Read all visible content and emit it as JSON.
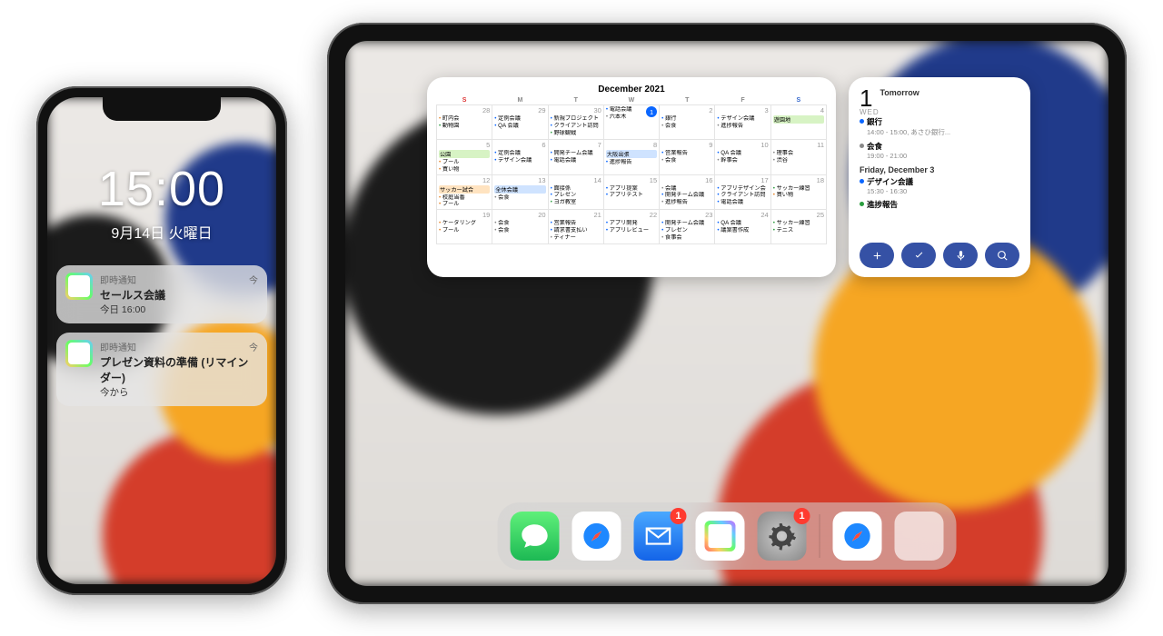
{
  "iphone": {
    "time": "15:00",
    "date": "9月14日 火曜日",
    "notifications": [
      {
        "app_label": "即時通知",
        "time_label": "今",
        "title": "セールス会議",
        "subtitle": "今日 16:00"
      },
      {
        "app_label": "即時通知",
        "time_label": "今",
        "title": "プレゼン資料の準備 (リマインダー)",
        "subtitle": "今から"
      }
    ]
  },
  "ipad": {
    "calendar_widget": {
      "title": "December 2021",
      "day_headers": [
        "S",
        "M",
        "T",
        "W",
        "T",
        "F",
        "S"
      ],
      "today_date": 1,
      "weeks": [
        [
          {
            "num": 28,
            "events": [
              {
                "c": "orange",
                "t": "町内会"
              },
              {
                "c": "green",
                "t": "動物園"
              }
            ]
          },
          {
            "num": 29,
            "events": [
              {
                "c": "blue",
                "t": "定例会議"
              },
              {
                "c": "blue",
                "t": "QA 会議"
              }
            ]
          },
          {
            "num": 30,
            "events": [
              {
                "c": "blue",
                "t": "新規プロジェクト"
              },
              {
                "c": "blue",
                "t": "クライアント訪問"
              },
              {
                "c": "green",
                "t": "野球観戦"
              }
            ]
          },
          {
            "num": 1,
            "today": true,
            "events": [
              {
                "c": "blue",
                "t": "電話会議"
              },
              {
                "c": "gray",
                "t": "六本木"
              }
            ]
          },
          {
            "num": 2,
            "events": [
              {
                "c": "blue",
                "t": "銀行"
              },
              {
                "c": "gray",
                "t": "会食"
              }
            ]
          },
          {
            "num": 3,
            "events": [
              {
                "c": "blue",
                "t": "デザイン会議"
              },
              {
                "c": "gray",
                "t": "進捗報告"
              }
            ]
          },
          {
            "num": 4,
            "allday": {
              "c": "green",
              "t": "遊園地"
            }
          }
        ],
        [
          {
            "num": 5,
            "allday": {
              "c": "green",
              "t": "公園"
            },
            "events": [
              {
                "c": "orange",
                "t": "プール"
              },
              {
                "c": "orange",
                "t": "買い物"
              }
            ]
          },
          {
            "num": 6,
            "events": [
              {
                "c": "blue",
                "t": "定例会議"
              },
              {
                "c": "blue",
                "t": "デザイン会議"
              }
            ]
          },
          {
            "num": 7,
            "events": [
              {
                "c": "blue",
                "t": "開発チーム会議"
              },
              {
                "c": "blue",
                "t": "電話会議"
              }
            ]
          },
          {
            "num": 8,
            "allday": {
              "c": "blue",
              "t": "大阪出張"
            },
            "events": [
              {
                "c": "blue",
                "t": "進捗報告"
              }
            ]
          },
          {
            "num": 9,
            "events": [
              {
                "c": "blue",
                "t": "営業報告"
              },
              {
                "c": "gray",
                "t": "会食"
              }
            ]
          },
          {
            "num": 10,
            "events": [
              {
                "c": "blue",
                "t": "QA 会議"
              },
              {
                "c": "gray",
                "t": "幹事会"
              }
            ]
          },
          {
            "num": 11,
            "events": [
              {
                "c": "gray",
                "t": "理事会"
              },
              {
                "c": "gray",
                "t": "渋谷"
              }
            ]
          }
        ],
        [
          {
            "num": 12,
            "allday": {
              "c": "orange",
              "t": "サッカー試合"
            },
            "events": [
              {
                "c": "orange",
                "t": "校庭当番"
              },
              {
                "c": "orange",
                "t": "プール"
              }
            ]
          },
          {
            "num": 13,
            "allday": {
              "c": "blue",
              "t": "全休会議"
            },
            "events": [
              {
                "c": "gray",
                "t": "会食"
              }
            ]
          },
          {
            "num": 14,
            "events": [
              {
                "c": "blue",
                "t": "面接係"
              },
              {
                "c": "blue",
                "t": "プレゼン"
              },
              {
                "c": "green",
                "t": "ヨガ教室"
              }
            ]
          },
          {
            "num": 15,
            "events": [
              {
                "c": "blue",
                "t": "アプリ提案"
              },
              {
                "c": "blue",
                "t": "アプリテスト"
              }
            ]
          },
          {
            "num": 16,
            "events": [
              {
                "c": "gray",
                "t": "会議"
              },
              {
                "c": "blue",
                "t": "開発チーム会議"
              },
              {
                "c": "gray",
                "t": "進捗報告"
              }
            ]
          },
          {
            "num": 17,
            "events": [
              {
                "c": "blue",
                "t": "アプリデザイン会"
              },
              {
                "c": "blue",
                "t": "クライアント訪問"
              },
              {
                "c": "blue",
                "t": "電話会議"
              }
            ]
          },
          {
            "num": 18,
            "events": [
              {
                "c": "green",
                "t": "サッカー練習"
              },
              {
                "c": "orange",
                "t": "買い物"
              }
            ]
          }
        ],
        [
          {
            "num": 19,
            "events": [
              {
                "c": "orange",
                "t": "ケータリング"
              },
              {
                "c": "orange",
                "t": "プール"
              }
            ]
          },
          {
            "num": 20,
            "events": [
              {
                "c": "gray",
                "t": "会食"
              },
              {
                "c": "gray",
                "t": "会食"
              }
            ]
          },
          {
            "num": 21,
            "events": [
              {
                "c": "blue",
                "t": "営業報告"
              },
              {
                "c": "blue",
                "t": "請求書支払い"
              },
              {
                "c": "gray",
                "t": "ディナー"
              }
            ]
          },
          {
            "num": 22,
            "events": [
              {
                "c": "blue",
                "t": "アプリ開発"
              },
              {
                "c": "blue",
                "t": "アプリレビュー"
              }
            ]
          },
          {
            "num": 23,
            "events": [
              {
                "c": "blue",
                "t": "開発チーム会議"
              },
              {
                "c": "blue",
                "t": "プレゼン"
              },
              {
                "c": "gray",
                "t": "食事会"
              }
            ]
          },
          {
            "num": 24,
            "events": [
              {
                "c": "blue",
                "t": "QA 会議"
              },
              {
                "c": "blue",
                "t": "議案書作成"
              }
            ]
          },
          {
            "num": 25,
            "events": [
              {
                "c": "green",
                "t": "サッカー練習"
              },
              {
                "c": "green",
                "t": "テニス"
              }
            ]
          }
        ]
      ]
    },
    "agenda_widget": {
      "date_num": "1",
      "date_wd": "WED",
      "groups": [
        {
          "label": "Tomorrow",
          "items": [
            {
              "c": "blue",
              "title": "銀行",
              "sub": "14:00 - 15:00, あさひ銀行..."
            },
            {
              "c": "gray",
              "title": "会食",
              "sub": "19:00 - 21:00"
            }
          ]
        },
        {
          "label": "Friday, December 3",
          "items": [
            {
              "c": "blue",
              "title": "デザイン会議",
              "sub": "15:30 - 16:30"
            },
            {
              "c": "green",
              "title": "進捗報告",
              "sub": ""
            }
          ]
        }
      ],
      "buttons": [
        "add",
        "check",
        "mic",
        "search"
      ]
    },
    "dock": {
      "apps": [
        "messages",
        "safari",
        "mail",
        "calapp",
        "settings"
      ],
      "recent": [
        "safari2",
        "library"
      ],
      "badges": {
        "mail": "1",
        "settings": "1"
      }
    }
  }
}
